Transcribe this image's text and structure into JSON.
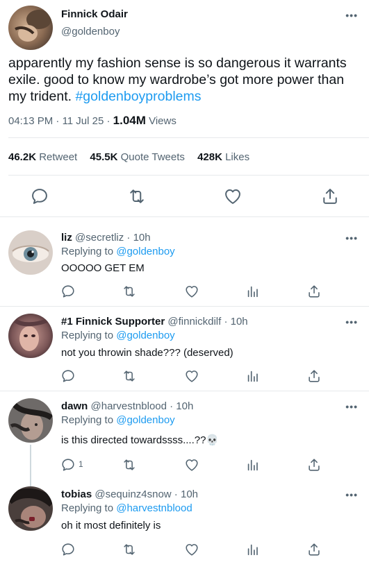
{
  "main_tweet": {
    "name": "Finnick Odair",
    "handle": "@goldenboy",
    "more": "•••",
    "text_part1": "apparently my fashion sense is so dangerous it warrants exile. good to know my wardrobe’s got more power than my trident. ",
    "hashtag": "#goldenboyproblems",
    "time": "04:13 PM",
    "sep1": " · ",
    "date": "11 Jul 25",
    "sep2": " · ",
    "views_count": "1.04M",
    "views_label": " Views",
    "retweets_count": "46.2K",
    "retweets_label": " Retweet",
    "quotes_count": "45.5K",
    "quotes_label": " Quote Tweets",
    "likes_count": "428K",
    "likes_label": " Likes"
  },
  "replies": [
    {
      "name": "liz",
      "handle": " @secretliz · 10h",
      "replying_label": "Replying to ",
      "replying_to": "@goldenboy",
      "text": "OOOOO GET EM",
      "reply_count": ""
    },
    {
      "name": "#1 Finnick Supporter",
      "handle": " @finnickdilf · 10h",
      "replying_label": "Replying to ",
      "replying_to": "@goldenboy",
      "text": "not you throwin shade??? (deserved)",
      "reply_count": ""
    },
    {
      "name": "dawn",
      "handle": " @harvestnblood · 10h",
      "replying_label": "Replying to ",
      "replying_to": "@goldenboy",
      "text": "is this directed towardssss....??💀",
      "reply_count": "1"
    },
    {
      "name": "tobias",
      "handle": " @sequinz4snow · 10h",
      "replying_label": "Replying to ",
      "replying_to": "@harvestnblood",
      "text": "oh it most definitely is",
      "reply_count": ""
    }
  ],
  "icons": {
    "reply": "reply-icon",
    "retweet": "retweet-icon",
    "like": "heart-icon",
    "views": "views-icon",
    "share": "share-icon",
    "more": "more-icon"
  },
  "colors": {
    "accent": "#1d9bf0",
    "secondary_text": "#536471",
    "primary_text": "#0f1419",
    "divider": "#e6e9eb"
  }
}
